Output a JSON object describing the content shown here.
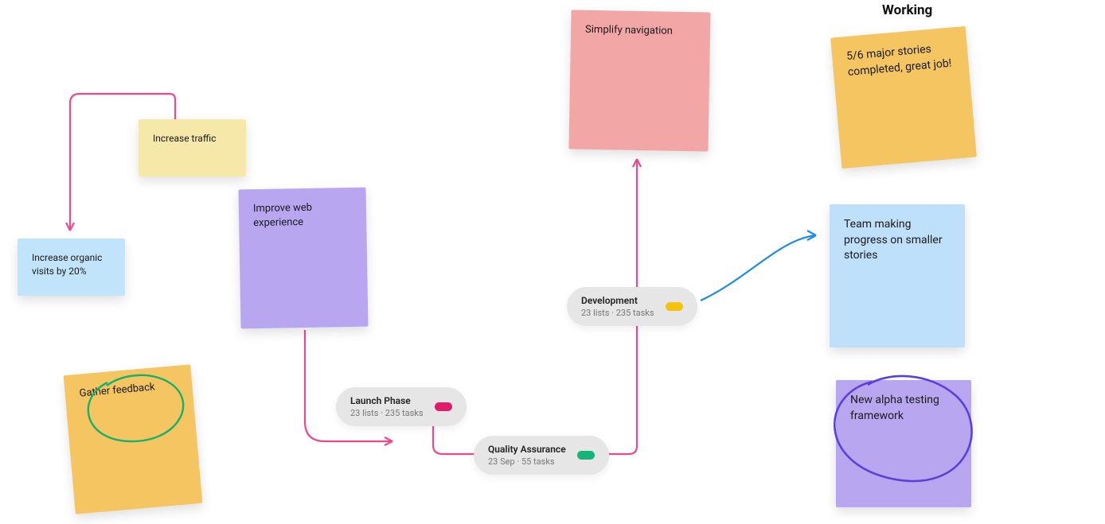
{
  "column_heading": "Working",
  "stickies": {
    "increase_traffic": {
      "text": "Increase traffic",
      "color": "#f6e8a8"
    },
    "increase_organic_visits": {
      "text": "Increase organic visits by 20%",
      "color": "#c2e4fb"
    },
    "improve_web": {
      "text": "Improve web experience",
      "color": "#b8a7f0"
    },
    "gather_feedback": {
      "text": "Gather feedback",
      "color": "#f4c560"
    },
    "simplify_navigation": {
      "text": "Simplify navigation",
      "color": "#f3a6a6"
    },
    "stories_completed": {
      "text": "5/6 major stories completed, great job!",
      "color": "#f4c560"
    },
    "team_progress": {
      "text": "Team making progress on smaller stories",
      "color": "#bfe0fb"
    },
    "alpha_testing": {
      "text": "New alpha testing framework",
      "color": "#b8a7f0"
    }
  },
  "nodes": {
    "launch_phase": {
      "title": "Launch Phase",
      "sub": "23 lists  ·  235 tasks",
      "pill_color": "#e01b6a"
    },
    "quality_assurance": {
      "title": "Quality Assurance",
      "sub": "23 Sep  ·  55 tasks",
      "pill_color": "#14b47b"
    },
    "development": {
      "title": "Development",
      "sub": "23 lists  ·  235 tasks",
      "pill_color": "#f4c310"
    }
  },
  "connectors": {
    "pink": "#ee4a8b",
    "blue": "#1f8ae0",
    "green_scribble": "#18b06b",
    "purple_scribble": "#5a41d8"
  }
}
